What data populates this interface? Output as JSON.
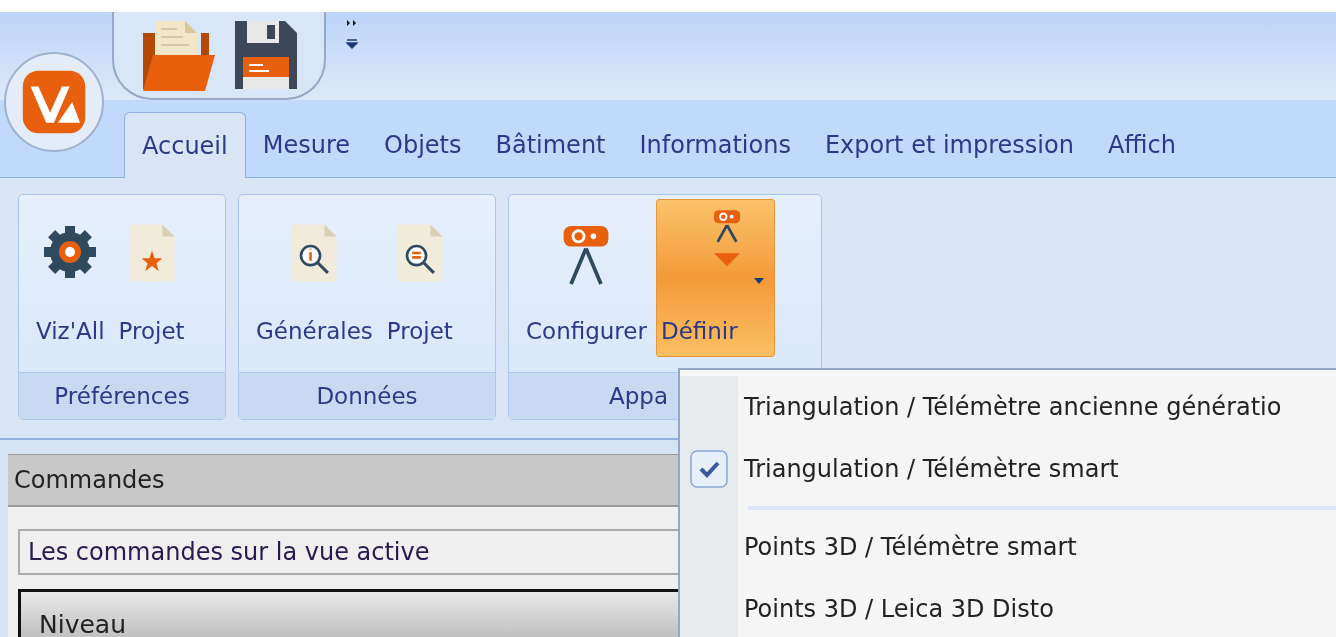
{
  "tabs": [
    {
      "label": "Accueil",
      "selected": true
    },
    {
      "label": "Mesure",
      "selected": false
    },
    {
      "label": "Objets",
      "selected": false
    },
    {
      "label": "Bâtiment",
      "selected": false
    },
    {
      "label": "Informations",
      "selected": false
    },
    {
      "label": "Export et impression",
      "selected": false
    },
    {
      "label": "Affich",
      "selected": false
    }
  ],
  "ribbon_groups": [
    {
      "label": "Préférences",
      "buttons": [
        {
          "label": "Viz'All",
          "active": false
        },
        {
          "label": "Projet",
          "active": false
        }
      ]
    },
    {
      "label": "Données",
      "buttons": [
        {
          "label": "Générales",
          "active": false
        },
        {
          "label": "Projet",
          "active": false
        }
      ]
    },
    {
      "label": "Appa",
      "buttons": [
        {
          "label": "Configurer",
          "active": false
        },
        {
          "label": "Définir",
          "active": true
        }
      ]
    }
  ],
  "dropdown_menu": [
    {
      "kind": "option",
      "label": "Triangulation / Télémètre ancienne génératio",
      "checked": false
    },
    {
      "kind": "option",
      "label": "Triangulation / Télémètre smart",
      "checked": true
    },
    {
      "kind": "separator"
    },
    {
      "kind": "option",
      "label": "Points 3D / Télémètre smart",
      "checked": false
    },
    {
      "kind": "option",
      "label": "Points 3D / Leica 3D Disto",
      "checked": false
    }
  ],
  "commands_panel": {
    "title": "Commandes",
    "scope_field": {
      "value": "Les commandes sur la vue active"
    },
    "section_header": "Niveau"
  }
}
